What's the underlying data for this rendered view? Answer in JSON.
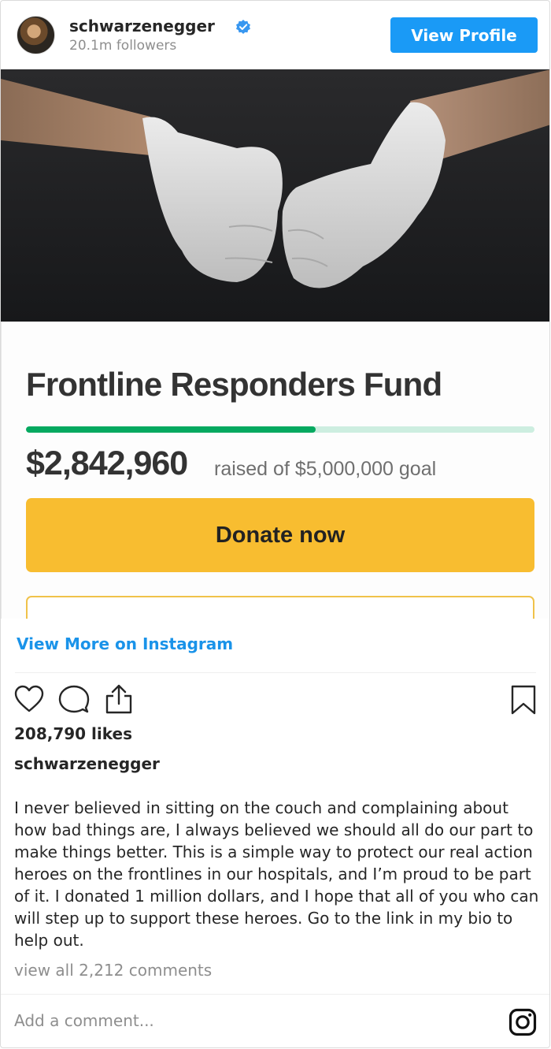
{
  "header": {
    "username": "schwarzenegger",
    "followers": "20.1m followers",
    "view_profile_label": "View Profile",
    "verified_icon": "verified-badge-icon",
    "accent_color": "#1a9af6"
  },
  "post": {
    "fund_title": "Frontline Responders Fund",
    "amount_raised": "$2,842,960",
    "goal_text": "raised of $5,000,000 goal",
    "progress_fraction": 0.57,
    "donate_label": "Donate now",
    "brand_green": "#05a960",
    "donate_color": "#f8bd30"
  },
  "view_more_label": "View More on Instagram",
  "actions": {
    "like_icon": "heart-icon",
    "comment_icon": "comment-icon",
    "share_icon": "share-icon",
    "save_icon": "bookmark-icon"
  },
  "likes": "208,790 likes",
  "caption": {
    "username": "schwarzenegger",
    "text": "I never believed in sitting on the couch and complaining about how bad things are, I always believed we should all do our part to make things better. This is a simple way to protect our real action heroes on the frontlines in our hospitals, and I’m proud to be part of it. I donated 1 million dollars, and I hope that all of you who can will step up to support these heroes. Go to the link in my bio to help out."
  },
  "comments_link": "view all 2,212 comments",
  "comment_placeholder": "Add a comment...",
  "footer_icon": "instagram-logo-icon"
}
